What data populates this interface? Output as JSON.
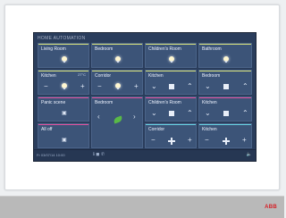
{
  "header": {
    "title": "HOME AUTOMATION"
  },
  "tiles": {
    "living_room": {
      "label": "Living Room"
    },
    "bedroom": {
      "label": "Bedroom"
    },
    "childrens_room": {
      "label": "Children's Room"
    },
    "bathroom": {
      "label": "Bathroom"
    },
    "kitchen": {
      "label": "Kitchen",
      "right": "27°C"
    },
    "corridor": {
      "label": "Corridor"
    },
    "kitchen_2": {
      "label": "Kitchen"
    },
    "bedroom_2": {
      "label": "Bedroom"
    },
    "panic_scene": {
      "label": "Panic scene"
    },
    "bedroom_3": {
      "label": "Bedroom"
    },
    "childrens_room_2": {
      "label": "Children's Room"
    },
    "kitchen_3": {
      "label": "Kitchen"
    },
    "all_off": {
      "label": "All off"
    },
    "corridor_2": {
      "label": "Corridor"
    },
    "kitchen_4": {
      "label": "Kitchen"
    }
  },
  "footer": {
    "status": "Fr 03/07/14   10:00",
    "icons": "ℹ  ◼  ✆",
    "volume": "🔈"
  },
  "brand": {
    "name": "ABB"
  },
  "colors": {
    "screen_bg": "#2a3d5c",
    "tile_bg": "#3c5478",
    "accent_yellow": "#d8e27a",
    "accent_pink": "#e24f9d",
    "accent_cyan": "#66d2e2",
    "brand_red": "#d61f26"
  }
}
